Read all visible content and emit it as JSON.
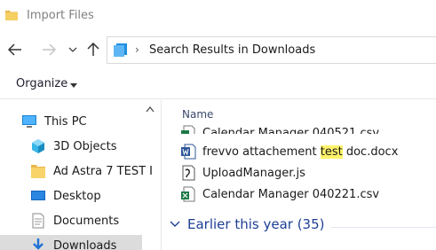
{
  "window": {
    "title": "Import Files"
  },
  "address": {
    "path": "Search Results in Downloads"
  },
  "toolbar": {
    "organize_label": "Organize"
  },
  "sidebar": {
    "items": [
      {
        "label": "This PC",
        "icon": "pc-icon"
      },
      {
        "label": "3D Objects",
        "icon": "cube-icon"
      },
      {
        "label": "Ad Astra 7 TEST I",
        "icon": "folder-icon"
      },
      {
        "label": "Desktop",
        "icon": "desktop-icon"
      },
      {
        "label": "Documents",
        "icon": "documents-icon"
      },
      {
        "label": "Downloads",
        "icon": "downloads-icon",
        "selected": true
      }
    ]
  },
  "file_list": {
    "column_name": "Name",
    "rows": [
      {
        "name": "Calendar Manager 040521.csv",
        "icon": "excel-csv-icon"
      },
      {
        "name_before": "frevvo attachement ",
        "name_highlight": "test",
        "name_after": " doc.docx",
        "icon": "word-doc-icon"
      },
      {
        "name": "UploadManager.js",
        "icon": "js-script-icon"
      },
      {
        "name": "Calendar Manager 040221.csv",
        "icon": "excel-csv-icon"
      }
    ],
    "group_label": "Earlier this year (35)"
  },
  "colors": {
    "highlight": "#fff36b",
    "group_text": "#1e3f96",
    "selected_bg": "#dcdcdc"
  }
}
